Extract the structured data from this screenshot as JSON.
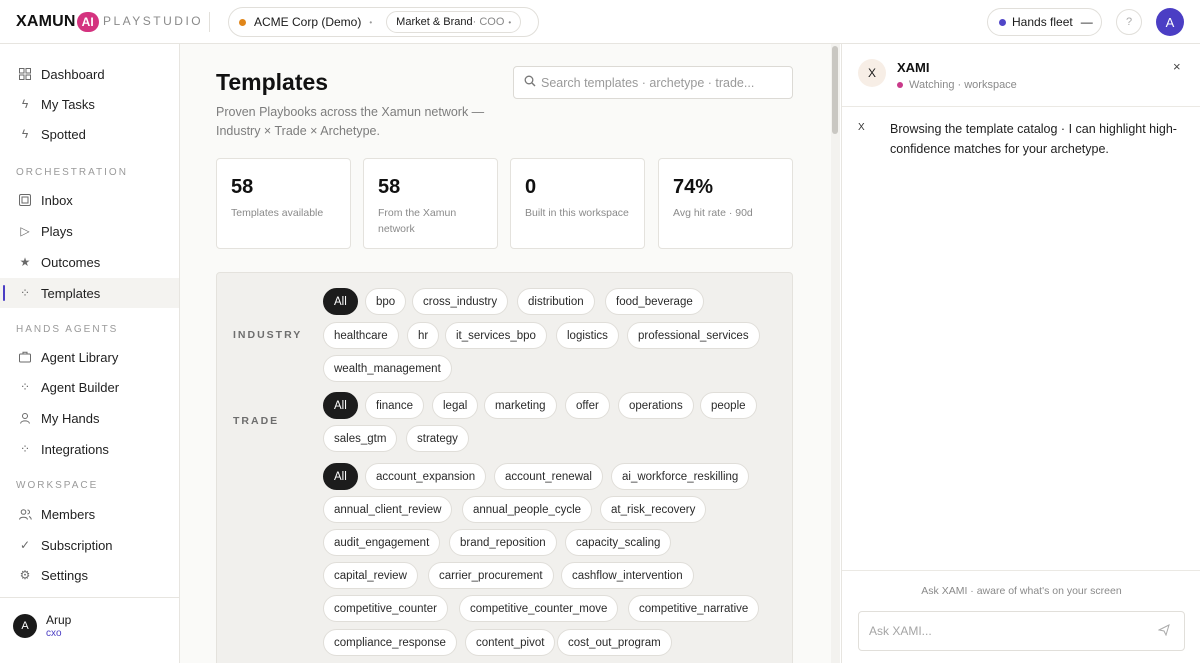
{
  "topbar": {
    "logo_text": "XAMUN",
    "logo_badge": "AI",
    "studio": "PLAYSTUDIO",
    "org": "ACME Corp (Demo)",
    "org_caret": "•",
    "role_main": "Market & Brand",
    "role_sub": " · COO",
    "role_caret": "•",
    "fleet_label": "Hands fleet",
    "fleet_value": "—",
    "help_icon": "?",
    "avatar": "A",
    "colors": {
      "org_dot": "#e0861a",
      "fleet_dot": "#5046c8",
      "avatar": "#4b3ec4"
    }
  },
  "sidebar": {
    "items_top": [
      {
        "label": "Dashboard",
        "icon": "grid-icon"
      },
      {
        "label": "My Tasks",
        "icon": "bolt-icon"
      },
      {
        "label": "Spotted",
        "icon": "bolt-icon"
      }
    ],
    "sections": [
      {
        "label": "ORCHESTRATION",
        "items": [
          {
            "label": "Inbox",
            "icon": "inbox-icon"
          },
          {
            "label": "Plays",
            "icon": "play-icon"
          },
          {
            "label": "Outcomes",
            "icon": "star-icon"
          },
          {
            "label": "Templates",
            "icon": "sparkle-icon",
            "active": true
          }
        ]
      },
      {
        "label": "HANDS AGENTS",
        "items": [
          {
            "label": "Agent Library",
            "icon": "briefcase-icon"
          },
          {
            "label": "Agent Builder",
            "icon": "sparkle-icon"
          },
          {
            "label": "My Hands",
            "icon": "user-icon"
          },
          {
            "label": "Integrations",
            "icon": "sparkle-icon"
          }
        ]
      },
      {
        "label": "WORKSPACE",
        "items": [
          {
            "label": "Members",
            "icon": "users-icon"
          },
          {
            "label": "Subscription",
            "icon": "check-icon"
          },
          {
            "label": "Settings",
            "icon": "gear-icon"
          }
        ]
      }
    ],
    "user": {
      "avatar": "A",
      "name": "Arup",
      "role": "cxo"
    }
  },
  "main": {
    "title": "Templates",
    "subtitle": "Proven Playbooks across the Xamun network — Industry × Trade × Archetype.",
    "search_placeholder": "Search templates · archetype · trade...",
    "stats": [
      {
        "value": "58",
        "caption": "Templates available"
      },
      {
        "value": "58",
        "caption": "From the Xamun network"
      },
      {
        "value": "0",
        "caption": "Built in this workspace"
      },
      {
        "value": "74%",
        "caption": "Avg hit rate · 90d"
      }
    ],
    "filters": {
      "industry_label": "INDUSTRY",
      "trade_label": "TRADE",
      "industry": [
        "All",
        "bpo",
        "cross_industry",
        "distribution",
        "food_beverage",
        "healthcare",
        "hr",
        "it_services_bpo",
        "logistics",
        "professional_services",
        "wealth_management"
      ],
      "trade": [
        "All",
        "finance",
        "legal",
        "marketing",
        "offer",
        "operations",
        "people",
        "sales_gtm",
        "strategy"
      ],
      "archetype": [
        "All",
        "account_expansion",
        "account_renewal",
        "ai_workforce_reskilling",
        "annual_client_review",
        "annual_people_cycle",
        "at_risk_recovery",
        "audit_engagement",
        "brand_reposition",
        "capacity_scaling",
        "capital_review",
        "carrier_procurement",
        "cashflow_intervention",
        "competitive_counter",
        "competitive_counter_move",
        "competitive_narrative",
        "compliance_response",
        "content_pivot",
        "cost_out_program"
      ]
    }
  },
  "panel": {
    "avatar": "X",
    "name": "XAMI",
    "status": "Watching · workspace",
    "close": "×",
    "message_avatar": "X",
    "message": "Browsing the template catalog · I can highlight high-confidence matches for your archetype.",
    "ask_hint": "Ask XAMI · aware of what's on your screen",
    "ask_placeholder": "Ask XAMI...",
    "send_icon": "send-icon"
  }
}
